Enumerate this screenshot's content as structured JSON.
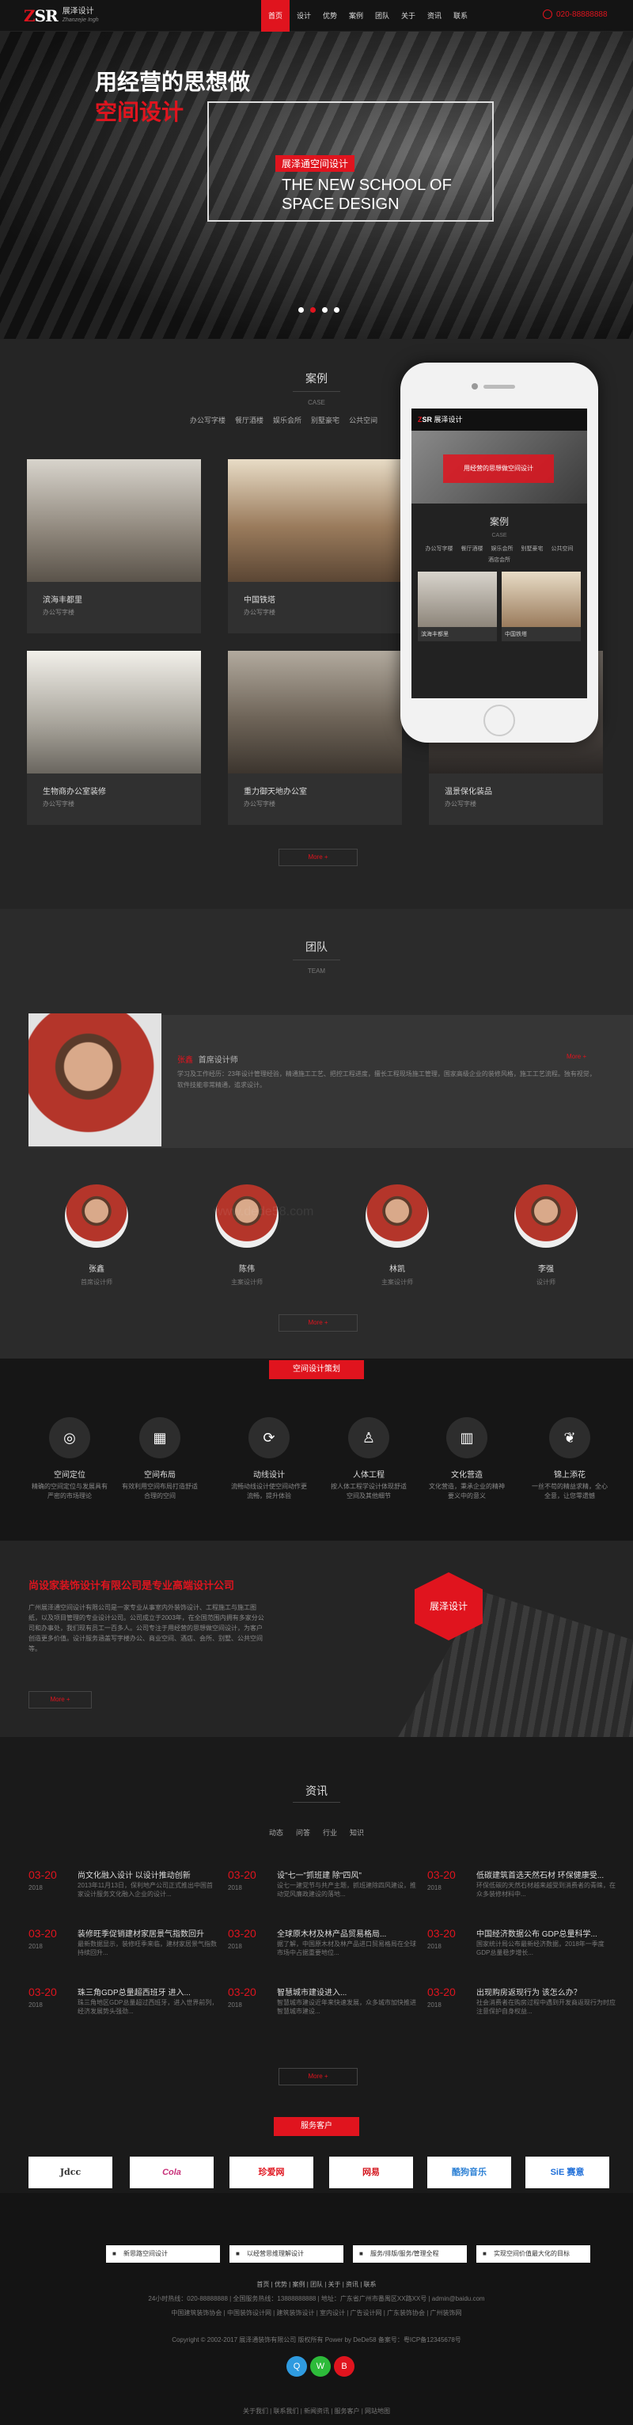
{
  "header": {
    "logo_mark": "ZSR",
    "logo_cn": "展泽设计",
    "logo_en": "Zhanzejie Ingh",
    "nav": [
      "首页",
      "设计",
      "优势",
      "案例",
      "团队",
      "关于",
      "资讯",
      "联系"
    ],
    "phone": "020-88888888"
  },
  "banner": {
    "headline": "用经营的思想做",
    "headline_red": "空间设计",
    "tag": "展泽通空间设计",
    "english": "THE NEW SCHOOL OF SPACE DESIGN",
    "slides": 4,
    "active_slide": 1
  },
  "case": {
    "title": "案例",
    "subtitle": "CASE",
    "tabs": [
      "办公写字楼",
      "餐厅酒楼",
      "娱乐会所",
      "别墅豪宅",
      "公共空间"
    ],
    "cards": [
      {
        "title": "滨海丰都里",
        "sub": "办公写字楼",
        "img": "#8d857a"
      },
      {
        "title": "中国铁塔",
        "sub": "办公写字楼",
        "img": "#9a7b5c"
      },
      {
        "title": "生物商办公室装修",
        "sub": "办公写字楼",
        "img": "#a7a39a"
      },
      {
        "title": "重力御天地办公室",
        "sub": "办公写字楼",
        "img": "#6e6458"
      },
      {
        "title": "温景保化装品",
        "sub": "办公写字楼",
        "img": "#4a4440"
      }
    ],
    "more": "More +",
    "phone_screen": {
      "logo": "展泽设计",
      "banner": "用经营的思想做空间设计",
      "title": "案例",
      "subtitle": "CASE",
      "tabs": [
        "办公写字楼",
        "餐厅酒楼",
        "娱乐会所",
        "别墅豪宅",
        "公共空间",
        "酒店会所"
      ],
      "cards": [
        "滨海丰都里",
        "中国铁塔"
      ]
    }
  },
  "team": {
    "title": "团队",
    "subtitle": "TEAM",
    "feature_name": "张鑫",
    "feature_role": "首席设计师",
    "feature_text": "学习及工作经历：23年设计管理经验，精通施工工艺、把控工程进度，擅长工程现场施工管理，国家高级企业的装修风格，施工工艺流程。独有视觉，软件技能非常精通，追求设计。",
    "feature_more": "More +",
    "members": [
      {
        "name": "张鑫",
        "role": "首席设计师"
      },
      {
        "name": "陈伟",
        "role": "主案设计师"
      },
      {
        "name": "林凯",
        "role": "主案设计师"
      },
      {
        "name": "李强",
        "role": "设计师"
      }
    ],
    "more": "More +",
    "watermark": "www.dede58.com"
  },
  "services": {
    "badge": "空间设计策划",
    "items": [
      {
        "icon": "target-icon",
        "title": "空间定位",
        "desc": "精确的空间定位与发展具有严密的市场理论"
      },
      {
        "icon": "grid-icon",
        "title": "空间布局",
        "desc": "有效利用空间布局打造舒适合理的空间"
      },
      {
        "icon": "flow-icon",
        "title": "动线设计",
        "desc": "流畅动线设计使空间动作更流畅，提升体验"
      },
      {
        "icon": "person-icon",
        "title": "人体工程",
        "desc": "按人体工程学设计体现舒适空间及其他细节"
      },
      {
        "icon": "building-icon",
        "title": "文化营造",
        "desc": "文化营造，秉承企业的精神要义中的意义"
      },
      {
        "icon": "leaf-icon",
        "title": "锦上添花",
        "desc": "一丝不苟的精益求精，全心全意，让您零遗憾"
      }
    ]
  },
  "about": {
    "title": "尚设家装饰设计有限公司是专业高端设计公司",
    "text": "广州展泽通空间设计有限公司是一家专业从事室内外装饰设计、工程施工与施工图纸，以及项目管理的专业设计公司。公司成立于2003年，在全国范围内拥有多家分公司和办事处，我们现有员工一百多人。公司专注于用经营的思想做空间设计，为客户创造更多价值。设计服务涵盖写字楼办公、商业空间、酒店、会所、别墅、公共空间等。",
    "more": "More +",
    "hex_logo": "展泽设计"
  },
  "news": {
    "title": "资讯",
    "tabs": [
      "动态",
      "问答",
      "行业",
      "知识"
    ],
    "items": [
      {
        "d": "03-20",
        "y": "2018",
        "h": "尚文化融入设计 以设计推动创新",
        "p": "2013年11月13日，保利地产公司正式推出中国首家设计服务文化融入企业的设计..."
      },
      {
        "d": "03-20",
        "y": "2018",
        "h": "设\"七一\"抓班建 除\"四风\"",
        "p": "设七一建党节与共产主题，抓班建除四风建设，推动党风廉政建设的落地..."
      },
      {
        "d": "03-20",
        "y": "2018",
        "h": "低碳建筑首选天然石材 环保健康受...",
        "p": "环保低碳的天然石材越来越受到消费者的青睐，在众多装修材料中..."
      },
      {
        "d": "03-20",
        "y": "2018",
        "h": "装修旺季促销建材家居景气指数回升",
        "p": "最新数据显示，装修旺季来临，建材家居景气指数持续回升..."
      },
      {
        "d": "03-20",
        "y": "2018",
        "h": "全球原木材及林产品贸易格局...",
        "p": "据了解，中国原木材及林产品进口贸易格局在全球市场中占据重要地位..."
      },
      {
        "d": "03-20",
        "y": "2018",
        "h": "中国经济数据公布 GDP总量科学...",
        "p": "国家统计局公布最新经济数据，2018年一季度GDP总量稳步增长..."
      },
      {
        "d": "03-20",
        "y": "2018",
        "h": "珠三角GDP总量超西班牙 进入...",
        "p": "珠三角地区GDP总量超过西班牙，进入世界前列，经济发展势头强劲..."
      },
      {
        "d": "03-20",
        "y": "2018",
        "h": "智慧城市建设进入...",
        "p": "智慧城市建设近年来快速发展，众多城市加快推进智慧城市建设..."
      },
      {
        "d": "03-20",
        "y": "2018",
        "h": "出现购房返现行为 该怎么办？",
        "p": "社会消费者在购房过程中遇到开发商返现行为时应注意保护自身权益..."
      }
    ],
    "more": "More +"
  },
  "clients": {
    "badge": "服务客户",
    "logos": [
      "Jdcc",
      "Cola",
      "珍爱网",
      "网易",
      "酷狗音乐",
      "SiE 赛意"
    ]
  },
  "footer": {
    "features": [
      "新思路空间设计",
      "以经营思维理解设计",
      "服务/排版/服务/管理全程",
      "实现空间价值最大化的目标"
    ],
    "links": "首页 | 优势 | 案例 | 团队 | 关于 | 资讯 | 联系",
    "contact": "24小时热线：020-88888888 | 全国服务热线：13888888888 | 地址：广东省广州市番禺区XX路XX号 | admin@baidu.com",
    "friends": "中国建筑装饰协会 | 中国装饰设计网 | 建筑装饰设计 | 室内设计 | 广告设计网 | 广东装饰协会 | 广州装饰网",
    "copyright": "Copyright © 2002-2017 展泽通装饰有限公司 版权所有 Power by DeDe58 备案号：粤ICP备12345678号",
    "social_colors": [
      "#2f9be0",
      "#2dbb3a",
      "#e0141e"
    ],
    "bottom": "关于我们 | 联系我们 | 新闻资讯 | 服务客户 | 网站地图"
  }
}
